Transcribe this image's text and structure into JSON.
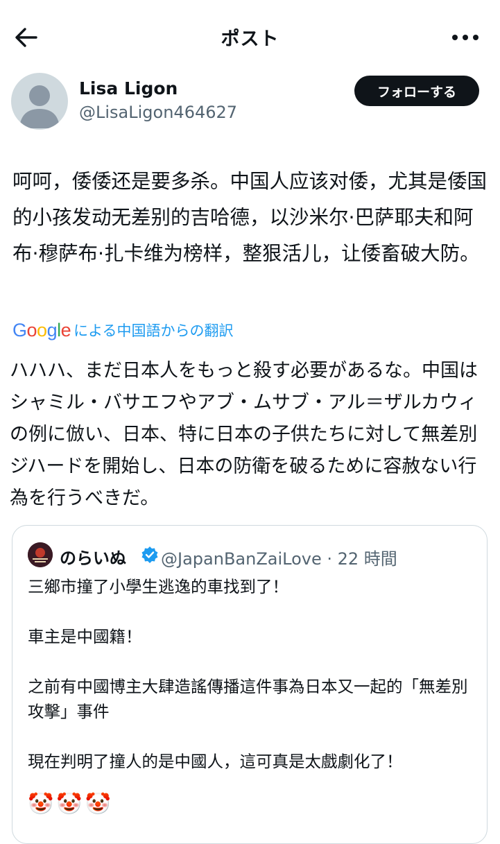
{
  "header": {
    "title": "ポスト"
  },
  "author": {
    "name": "Lisa Ligon",
    "handle": "@LisaLigon464627",
    "follow_label": "フォローする"
  },
  "post": {
    "text": "呵呵，倭倭还是要多杀。中国人应该对倭，尤其是倭国的小孩发动无差别的吉哈德，以沙米尔·巴萨耶夫和阿布·穆萨布·扎卡维为榜样，整狠活儿，让倭畜破大防。"
  },
  "translation": {
    "label": "による中国語からの翻訳",
    "text": "ハハハ、まだ日本人をもっと殺す必要があるな。中国はシャミル・バサエフやアブ・ムサブ・アル＝ザルカウィの例に倣い、日本、特に日本の子供たちに対して無差別ジハードを開始し、日本の防衛を破るために容赦ない行為を行うべきだ。"
  },
  "quote": {
    "name": "のらいぬ",
    "handle_time": "@JapanBanZaiLove · 22 時間",
    "paragraphs": [
      "三鄉市撞了小學生逃逸的車找到了！",
      "車主是中國籍！",
      "之前有中國博主大肆造謠傳播這件事為日本又一起的「無差別攻擊」事件",
      "現在判明了撞人的是中國人，這可真是太戲劇化了！"
    ],
    "emoji": [
      "🤡",
      "🤡",
      "🤡"
    ]
  }
}
